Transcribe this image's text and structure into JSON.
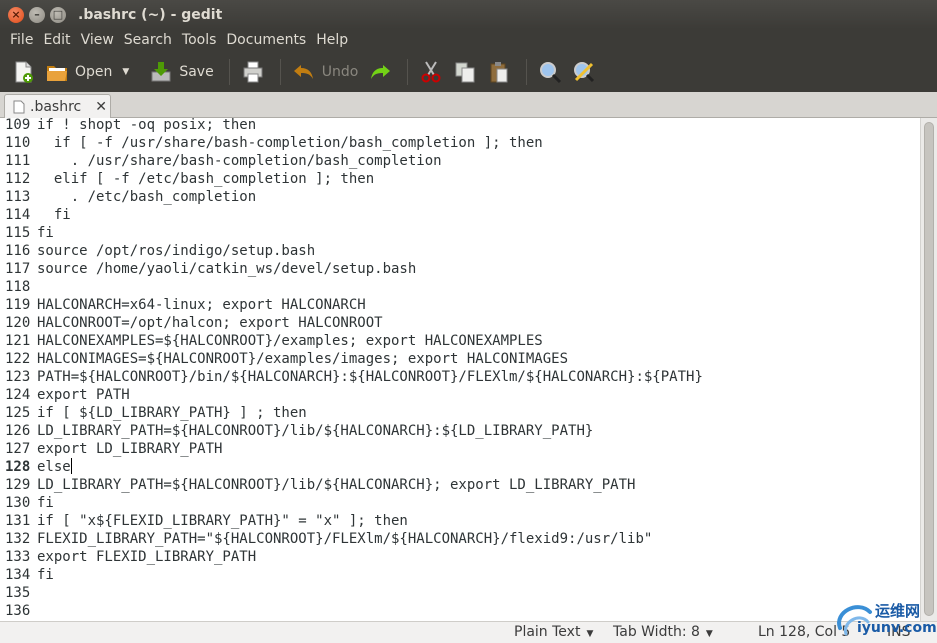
{
  "window": {
    "title": ".bashrc (~) - gedit"
  },
  "menubar": {
    "items": [
      "File",
      "Edit",
      "View",
      "Search",
      "Tools",
      "Documents",
      "Help"
    ]
  },
  "toolbar": {
    "new_icon": "new-document-icon",
    "open_label": "Open",
    "save_label": "Save",
    "print_icon": "print-icon",
    "undo_label": "Undo",
    "redo_icon": "redo-icon",
    "cut_icon": "cut-icon",
    "copy_icon": "copy-icon",
    "paste_icon": "paste-icon",
    "find_icon": "search-icon",
    "replace_icon": "find-replace-icon"
  },
  "tab": {
    "label": ".bashrc",
    "close": "✕"
  },
  "editor": {
    "current_line": 128,
    "lines": [
      {
        "n": "109",
        "t": "if ! shopt -oq posix; then"
      },
      {
        "n": "110",
        "t": "  if [ -f /usr/share/bash-completion/bash_completion ]; then"
      },
      {
        "n": "111",
        "t": "    . /usr/share/bash-completion/bash_completion"
      },
      {
        "n": "112",
        "t": "  elif [ -f /etc/bash_completion ]; then"
      },
      {
        "n": "113",
        "t": "    . /etc/bash_completion"
      },
      {
        "n": "114",
        "t": "  fi"
      },
      {
        "n": "115",
        "t": "fi"
      },
      {
        "n": "116",
        "t": "source /opt/ros/indigo/setup.bash"
      },
      {
        "n": "117",
        "t": "source /home/yaoli/catkin_ws/devel/setup.bash"
      },
      {
        "n": "118",
        "t": ""
      },
      {
        "n": "119",
        "t": "HALCONARCH=x64-linux; export HALCONARCH"
      },
      {
        "n": "120",
        "t": "HALCONROOT=/opt/halcon; export HALCONROOT"
      },
      {
        "n": "121",
        "t": "HALCONEXAMPLES=${HALCONROOT}/examples; export HALCONEXAMPLES"
      },
      {
        "n": "122",
        "t": "HALCONIMAGES=${HALCONROOT}/examples/images; export HALCONIMAGES"
      },
      {
        "n": "123",
        "t": "PATH=${HALCONROOT}/bin/${HALCONARCH}:${HALCONROOT}/FLEXlm/${HALCONARCH}:${PATH}"
      },
      {
        "n": "124",
        "t": "export PATH"
      },
      {
        "n": "125",
        "t": "if [ ${LD_LIBRARY_PATH} ] ; then"
      },
      {
        "n": "126",
        "t": "LD_LIBRARY_PATH=${HALCONROOT}/lib/${HALCONARCH}:${LD_LIBRARY_PATH}"
      },
      {
        "n": "127",
        "t": "export LD_LIBRARY_PATH"
      },
      {
        "n": "128",
        "t": "else"
      },
      {
        "n": "129",
        "t": "LD_LIBRARY_PATH=${HALCONROOT}/lib/${HALCONARCH}; export LD_LIBRARY_PATH"
      },
      {
        "n": "130",
        "t": "fi"
      },
      {
        "n": "131",
        "t": "if [ \"x${FLEXID_LIBRARY_PATH}\" = \"x\" ]; then"
      },
      {
        "n": "132",
        "t": "FLEXID_LIBRARY_PATH=\"${HALCONROOT}/FLEXlm/${HALCONARCH}/flexid9:/usr/lib\""
      },
      {
        "n": "133",
        "t": "export FLEXID_LIBRARY_PATH"
      },
      {
        "n": "134",
        "t": "fi"
      },
      {
        "n": "135",
        "t": ""
      },
      {
        "n": "136",
        "t": ""
      }
    ]
  },
  "statusbar": {
    "language": "Plain Text",
    "tab_width": "Tab Width: 8",
    "position": "Ln 128, Col 5",
    "mode": "INS"
  },
  "watermark": {
    "line1": "运维网",
    "line2": "iyunv.com"
  },
  "colors": {
    "titlebar": "#3c3b37",
    "close_button": "#df4a16",
    "editor_bg": "#ffffff"
  }
}
